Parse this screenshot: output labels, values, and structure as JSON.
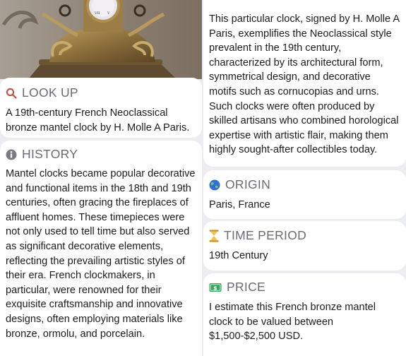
{
  "lookup": {
    "label": "LOOK UP",
    "text": "A 19th-century French Neoclassical bronze mantel clock by H. Molle A Paris."
  },
  "history": {
    "label": "HISTORY",
    "text": "Mantel clocks became popular decorative and functional items in the 18th and 19th centuries, often gracing the fireplaces of affluent homes. These timepieces were not only used to tell time but also served as significant decorative elements, reflecting the prevailing artistic styles of their era. French clockmakers, in particular, were renowned for their exquisite craftsmanship and innovative designs, often employing materials like bronze, ormolu, and porcelain."
  },
  "continuation": {
    "text": "This particular clock, signed by H. Molle A Paris, exemplifies the Neoclassical style prevalent in the 19th century, characterized by its architectural form, symmetrical design, and decorative motifs such as cornucopias and urns. Such clocks were often produced by skilled artisans who combined horological expertise with artistic flair, making them highly sought-after collectibles today."
  },
  "origin": {
    "label": "ORIGIN",
    "value": "Paris, France"
  },
  "time_period": {
    "label": "TIME PERIOD",
    "value": "19th Century"
  },
  "price": {
    "label": "PRICE",
    "text": "I estimate this French bronze mantel clock to be valued between $1,500-$2,500 USD."
  },
  "colors": {
    "search_icon": "#d0473b",
    "info_icon": "#7a7b82",
    "globe_icon": "#2f6fd6",
    "hourglass_icon": "#e0a528",
    "money_icon": "#3aa35c",
    "heading": "#6a6b72"
  },
  "icons": [
    "search-icon",
    "info-icon",
    "globe-icon",
    "hourglass-icon",
    "money-icon"
  ]
}
